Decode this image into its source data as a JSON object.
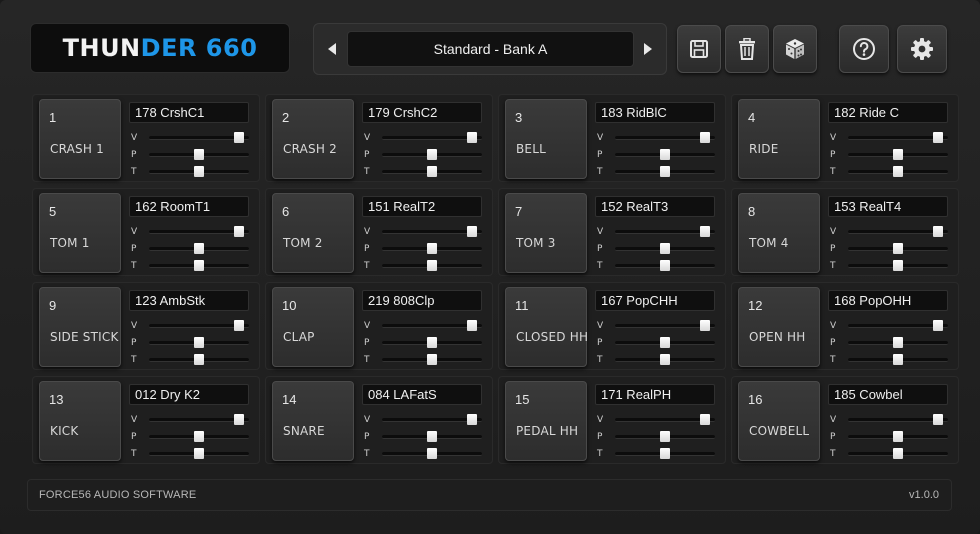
{
  "header": {
    "logo": {
      "part1": "THUN",
      "part2": "DER",
      "part3": " 660"
    },
    "preset": {
      "name": "Standard - Bank A",
      "prev_icon": "chevron-left-icon",
      "next_icon": "chevron-right-icon"
    },
    "toolbar": [
      {
        "id": "save",
        "icon": "save-icon"
      },
      {
        "id": "delete",
        "icon": "trash-icon"
      },
      {
        "id": "randomize",
        "icon": "dice-icon"
      },
      {
        "id": "help",
        "icon": "help-icon"
      },
      {
        "id": "settings",
        "icon": "gear-icon"
      }
    ]
  },
  "colors": {
    "accent": "#1e96e8",
    "background": "#1d1d1d",
    "pad": "#333333",
    "knob": "#f0f0f0"
  },
  "slider_labels": [
    "V",
    "P",
    "T"
  ],
  "pads": [
    {
      "number": "1",
      "name": "CRASH 1",
      "sample": "178 CrshC1",
      "v": 0.9,
      "p": 0.5,
      "t": 0.5
    },
    {
      "number": "2",
      "name": "CRASH 2",
      "sample": "179 CrshC2",
      "v": 0.9,
      "p": 0.5,
      "t": 0.5
    },
    {
      "number": "3",
      "name": "BELL",
      "sample": "183 RidBlC",
      "v": 0.9,
      "p": 0.5,
      "t": 0.5
    },
    {
      "number": "4",
      "name": "RIDE",
      "sample": "182 Ride C",
      "v": 0.9,
      "p": 0.5,
      "t": 0.5
    },
    {
      "number": "5",
      "name": "TOM 1",
      "sample": "162 RoomT1",
      "v": 0.9,
      "p": 0.5,
      "t": 0.5
    },
    {
      "number": "6",
      "name": "TOM 2",
      "sample": "151 RealT2",
      "v": 0.9,
      "p": 0.5,
      "t": 0.5
    },
    {
      "number": "7",
      "name": "TOM 3",
      "sample": "152 RealT3",
      "v": 0.9,
      "p": 0.5,
      "t": 0.5
    },
    {
      "number": "8",
      "name": "TOM 4",
      "sample": "153 RealT4",
      "v": 0.9,
      "p": 0.5,
      "t": 0.5
    },
    {
      "number": "9",
      "name": "SIDE STICK",
      "sample": "123 AmbStk",
      "v": 0.9,
      "p": 0.5,
      "t": 0.5
    },
    {
      "number": "10",
      "name": "CLAP",
      "sample": "219 808Clp",
      "v": 0.9,
      "p": 0.5,
      "t": 0.5
    },
    {
      "number": "11",
      "name": "CLOSED HH",
      "sample": "167 PopCHH",
      "v": 0.9,
      "p": 0.5,
      "t": 0.5
    },
    {
      "number": "12",
      "name": "OPEN HH",
      "sample": "168 PopOHH",
      "v": 0.9,
      "p": 0.5,
      "t": 0.5
    },
    {
      "number": "13",
      "name": "KICK",
      "sample": "012 Dry K2",
      "v": 0.9,
      "p": 0.5,
      "t": 0.5
    },
    {
      "number": "14",
      "name": "SNARE",
      "sample": "084 LAFatS",
      "v": 0.9,
      "p": 0.5,
      "t": 0.5
    },
    {
      "number": "15",
      "name": "PEDAL HH",
      "sample": "171 RealPH",
      "v": 0.9,
      "p": 0.5,
      "t": 0.5
    },
    {
      "number": "16",
      "name": "COWBELL",
      "sample": "185 Cowbel",
      "v": 0.9,
      "p": 0.5,
      "t": 0.5
    }
  ],
  "footer": {
    "company": "FORCE56 AUDIO SOFTWARE",
    "version": "v1.0.0"
  }
}
